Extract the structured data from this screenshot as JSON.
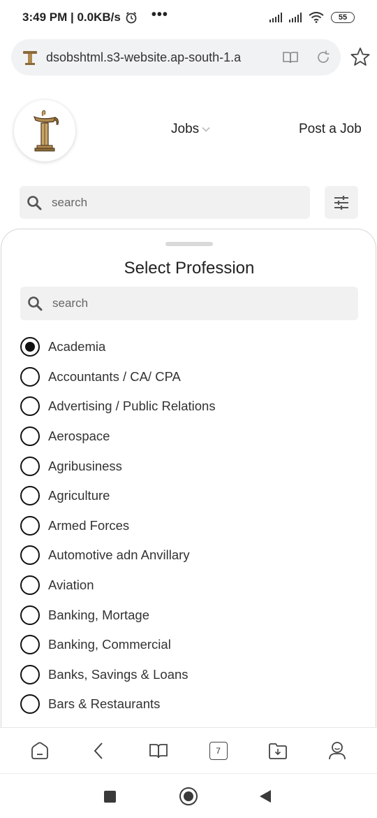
{
  "status_bar": {
    "time_speed": "3:49 PM | 0.0KB/s",
    "more": "•••",
    "battery": "55"
  },
  "browser": {
    "url": "dsobshtml.s3-website.ap-south-1.a",
    "tab_count": "7"
  },
  "header": {
    "nav_jobs": "Jobs",
    "nav_post_job": "Post a Job"
  },
  "search": {
    "placeholder": "search"
  },
  "sheet": {
    "title": "Select Profession",
    "search_placeholder": "search",
    "selected_index": 0,
    "options": [
      "Academia",
      "Accountants / CA/ CPA",
      "Advertising / Public Relations",
      "Aerospace",
      "Agribusiness",
      "Agriculture",
      "Armed Forces",
      "Automotive adn Anvillary",
      "Aviation",
      "Banking, Mortage",
      "Banking, Commercial",
      "Banks, Savings & Loans",
      "Bars & Restaurants"
    ]
  },
  "colors": {
    "accent_logo": "#b08a4e",
    "surface_gray": "#f1f1f1"
  },
  "icons": {
    "url_logo": "site-logo-icon",
    "reader": "book-icon",
    "reload": "reload-icon",
    "bookmark": "star-icon",
    "search": "search-icon",
    "filter": "sliders-icon",
    "home": "home-icon",
    "back": "back-icon",
    "bookmarks": "book-icon",
    "tabs": "tabs-icon",
    "downloads": "download-folder-icon",
    "profile": "profile-icon"
  }
}
